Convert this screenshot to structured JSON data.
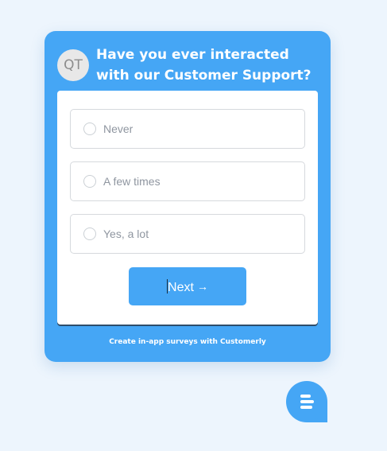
{
  "survey": {
    "avatar_initials": "QT",
    "question": "Have you ever interacted with our Customer Support?",
    "options": [
      {
        "label": "Never"
      },
      {
        "label": "A few times"
      },
      {
        "label": "Yes, a lot"
      }
    ],
    "next_label": "Next",
    "next_icon": "→",
    "footer_text": "Create in-app surveys with Customerly"
  },
  "colors": {
    "accent": "#45a6f5",
    "page_background": "#edf5fd",
    "panel": "#ffffff",
    "option_text": "#8f96a0"
  },
  "launcher": {
    "icon": "chat-icon"
  }
}
